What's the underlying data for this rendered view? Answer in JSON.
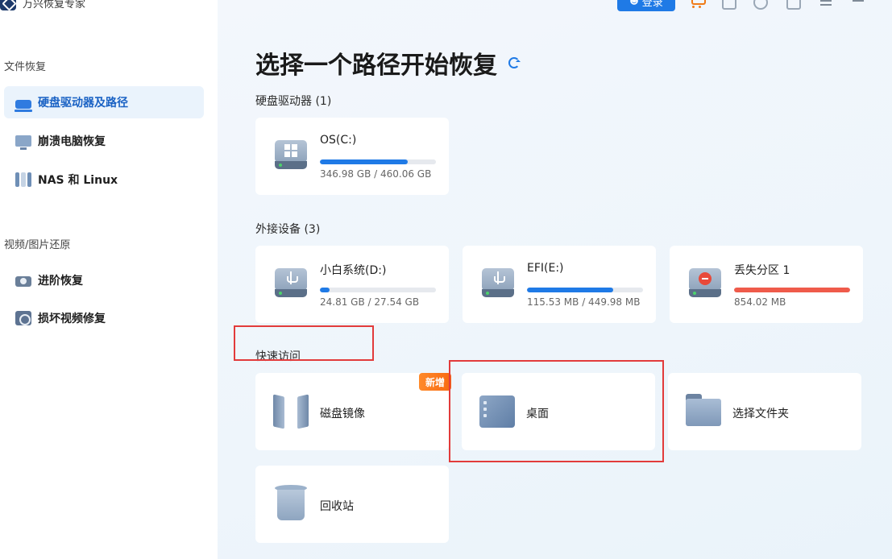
{
  "app": {
    "title": "万兴恢复专家"
  },
  "sidebar": {
    "groups": [
      {
        "title": "文件恢复",
        "items": [
          {
            "label": "硬盘驱动器及路径",
            "icon": "drive-icon",
            "active": true
          },
          {
            "label": "崩溃电脑恢复",
            "icon": "monitor-icon"
          },
          {
            "label": "NAS 和 Linux",
            "icon": "nas-icon"
          }
        ]
      },
      {
        "title": "视频/图片还原",
        "items": [
          {
            "label": "进阶恢复",
            "icon": "camera-icon"
          },
          {
            "label": "损坏视频修复",
            "icon": "video-repair-icon"
          }
        ]
      }
    ]
  },
  "topbar": {
    "login_label": "登录",
    "icons": [
      "cart-icon",
      "exit-icon",
      "support-icon",
      "bag-icon",
      "menu-icon",
      "minimize-icon"
    ]
  },
  "main": {
    "heading": "选择一个路径开始恢复",
    "hard_drives": {
      "title": "硬盘驱动器 (1)",
      "items": [
        {
          "name": "OS(C:)",
          "size": "346.98 GB / 460.06 GB",
          "usage": 0.754,
          "color": "#1f7ae6"
        }
      ]
    },
    "external": {
      "title": "外接设备 (3)",
      "items": [
        {
          "name": "小白系统(D:)",
          "size": "24.81 GB / 27.54 GB",
          "usage": 0.08,
          "color": "#1f7ae6"
        },
        {
          "name": "EFI(E:)",
          "size": "115.53 MB / 449.98 MB",
          "usage": 0.74,
          "color": "#1f7ae6"
        },
        {
          "name": "丢失分区 1",
          "size": "854.02 MB",
          "usage": 1.0,
          "color": "#ef5b4b"
        }
      ]
    },
    "quick_access": {
      "title": "快速访问",
      "new_badge": "新增",
      "items": [
        {
          "name": "磁盘镜像",
          "icon": "disk-image-icon"
        },
        {
          "name": "桌面",
          "icon": "desktop-icon"
        },
        {
          "name": "选择文件夹",
          "icon": "folder-icon"
        },
        {
          "name": "回收站",
          "icon": "recycle-bin-icon"
        }
      ]
    }
  },
  "colors": {
    "accent": "#1f7ae6",
    "highlight": "#e23b3b",
    "badge": "#f86a12"
  }
}
